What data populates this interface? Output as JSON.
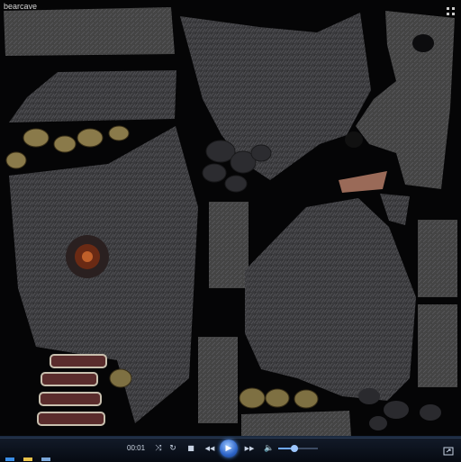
{
  "window": {
    "title": "bearcave"
  },
  "player": {
    "time": "00:01",
    "volume_percent": 40,
    "buttons": {
      "shuffle": "⤨",
      "repeat": "↻",
      "stop": "■",
      "previous": "◀◀",
      "play": "▶",
      "next": "▶▶",
      "volume": "🔈"
    }
  },
  "icons": {
    "expand": "expand-icon",
    "switch_to_library": "switch-view-icon",
    "taskbar": [
      "start-icon",
      "folder-icon",
      "media-player-icon"
    ]
  }
}
